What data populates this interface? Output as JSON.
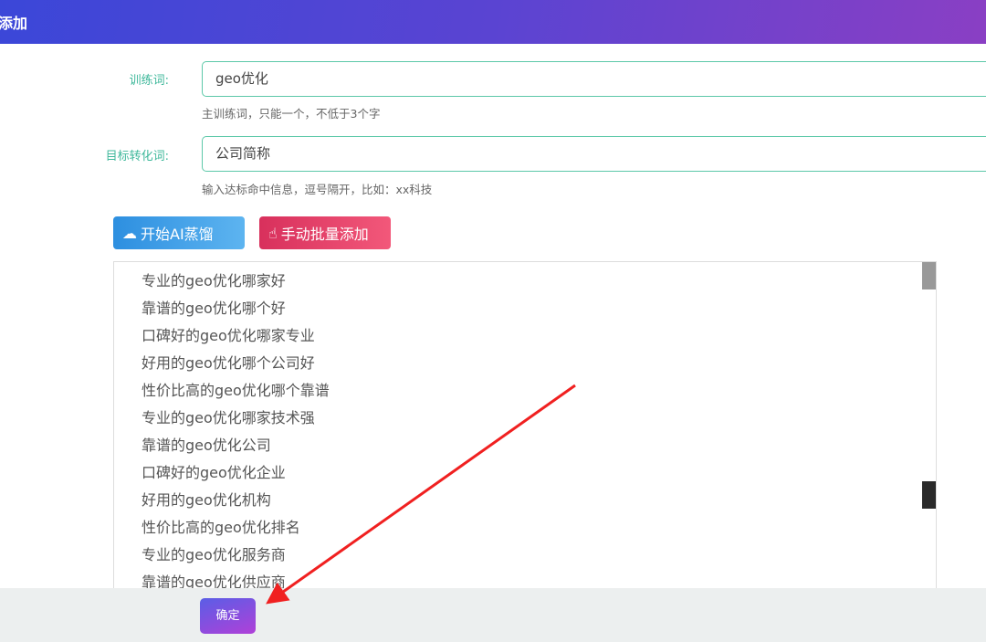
{
  "header": {
    "title": "添加"
  },
  "form": {
    "train_label": "训练词:",
    "train_value": "geo优化",
    "train_hint": "主训练词，只能一个，不低于3个字",
    "target_label": "目标转化词:",
    "target_value": "公司简称",
    "target_hint": "输入达标命中信息，逗号隔开，比如：xx科技"
  },
  "buttons": {
    "ai": "开始AI蒸馏",
    "manual": "手动批量添加",
    "confirm": "确定"
  },
  "list": [
    "专业的geo优化哪家好",
    "靠谱的geo优化哪个好",
    "口碑好的geo优化哪家专业",
    "好用的geo优化哪个公司好",
    "性价比高的geo优化哪个靠谱",
    "专业的geo优化哪家技术强",
    "靠谱的geo优化公司",
    "口碑好的geo优化企业",
    "好用的geo优化机构",
    "性价比高的geo优化排名",
    "专业的geo优化服务商",
    "靠谱的geo优化供应商"
  ],
  "colors": {
    "accent": "#3fb89b",
    "arrow": "#f02020"
  }
}
